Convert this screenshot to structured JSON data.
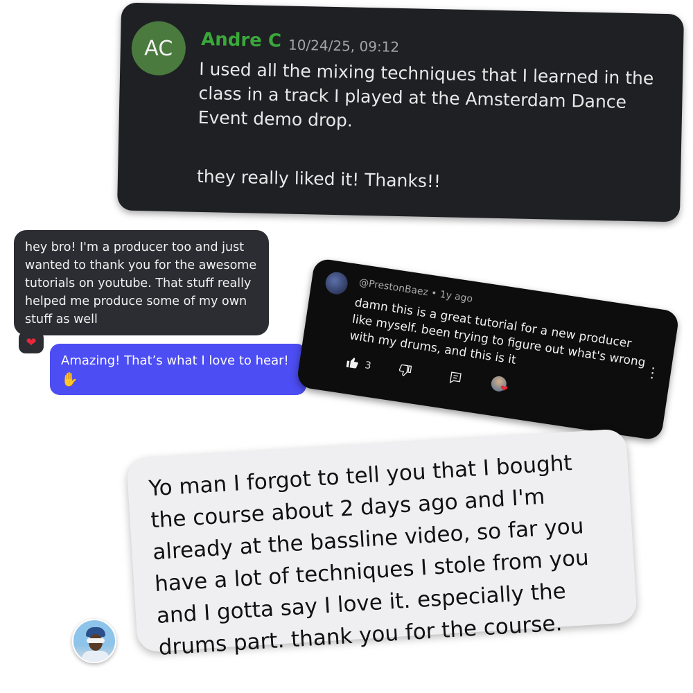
{
  "discord": {
    "avatar_initials": "AC",
    "avatar_color": "#4a7a3e",
    "username": "Andre C",
    "username_color": "#3aa83a",
    "timestamp": "10/24/25, 09:12",
    "message": "I used all the mixing techniques that I learned in the class in a track I played at the Amsterdam Dance Event demo drop.",
    "message_2": "they really liked it! Thanks!!"
  },
  "dm": {
    "incoming": "hey bro! I'm a producer too and just wanted to thank you for the awesome tutorials on youtube. That stuff really helped me produce some of my own stuff as well",
    "reaction_icon": "heart-icon",
    "outgoing": "Amazing! That’s what I love to hear!",
    "outgoing_icon": "flexed-biceps-icon",
    "outgoing_color": "#4c4df2"
  },
  "youtube": {
    "handle": "@PrestonBaez",
    "age": "1y ago",
    "comment": "damn this is a great tutorial for a new producer like myself. been trying to figure out what's wrong with my drums, and this is it",
    "likes": "3",
    "icons": [
      "thumbs-up-icon",
      "thumbs-down-icon",
      "reply-icon",
      "creator-heart-icon",
      "more-options-icon"
    ]
  },
  "imessage": {
    "text": "Yo man I forgot to tell you that I bought the course about 2 days ago and I'm already at the bassline video, so far you have a lot of techniques I stole from you and I gotta say I love it. especially the drums part. thank you for the course."
  }
}
